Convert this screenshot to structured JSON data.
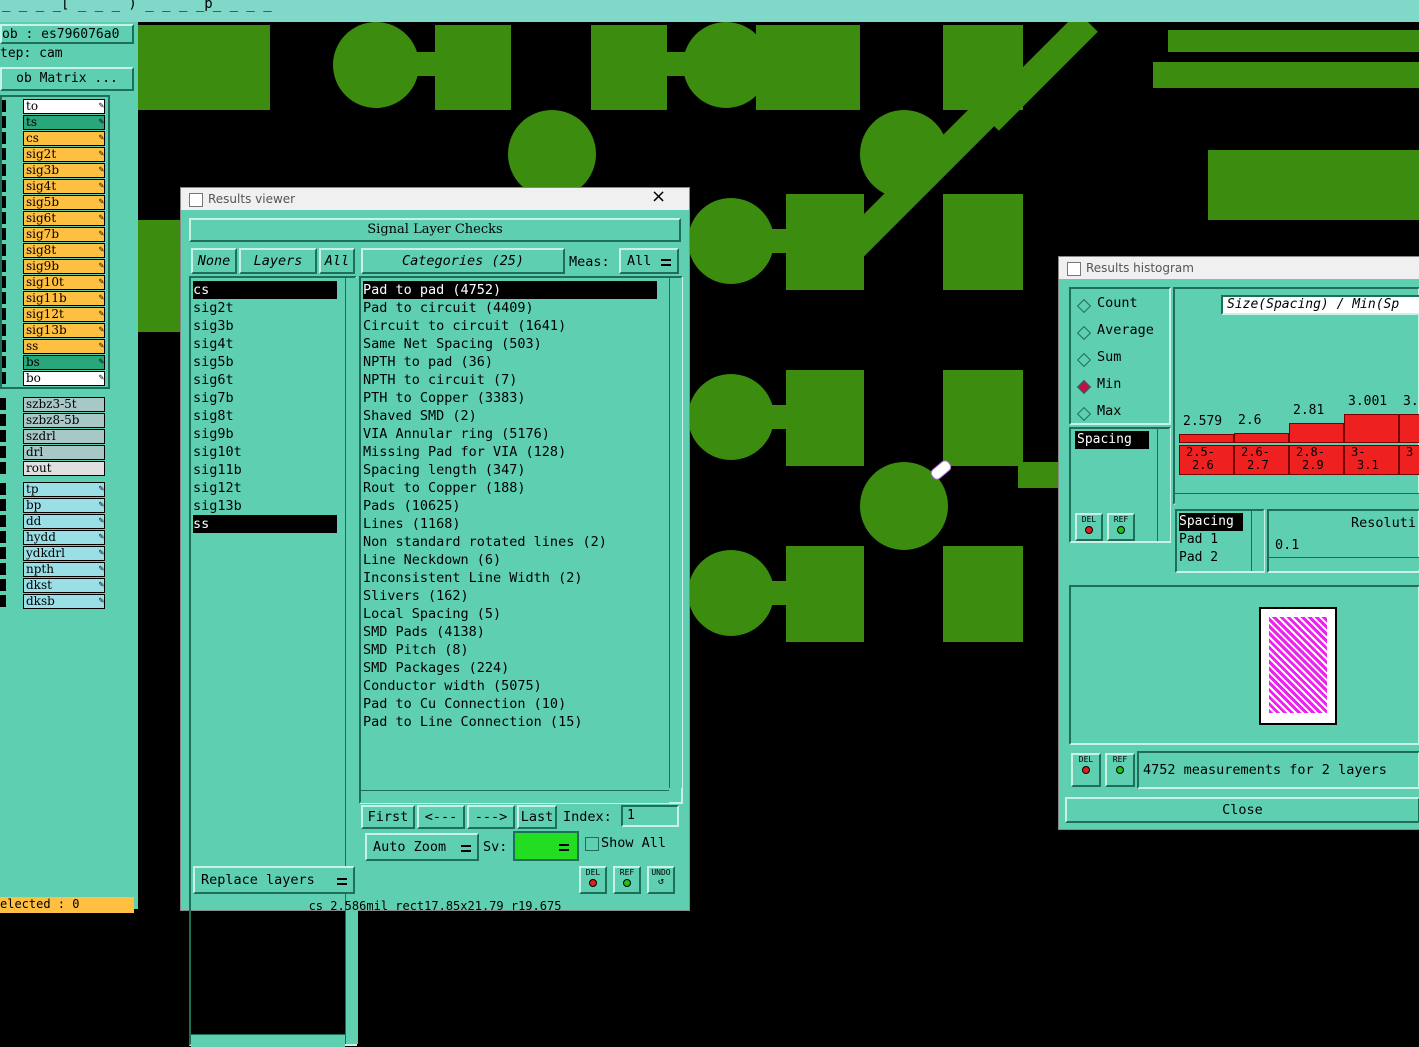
{
  "topbar": {
    "text": "_ _ _ _[ _ _ _ )  _ _ _ _p_ _ _  _"
  },
  "left_panel": {
    "job": "ob : es796076a0",
    "step": "tep: cam",
    "job_matrix": "ob Matrix ...",
    "layers_group1": [
      {
        "name": "to",
        "color": "#ffffff"
      },
      {
        "name": "ts",
        "color": "#2aa77a"
      },
      {
        "name": "cs",
        "color": "#ffbf40"
      },
      {
        "name": "sig2t",
        "color": "#ffbf40"
      },
      {
        "name": "sig3b",
        "color": "#ffbf40"
      },
      {
        "name": "sig4t",
        "color": "#ffbf40"
      },
      {
        "name": "sig5b",
        "color": "#ffbf40"
      },
      {
        "name": "sig6t",
        "color": "#ffbf40"
      },
      {
        "name": "sig7b",
        "color": "#ffbf40"
      },
      {
        "name": "sig8t",
        "color": "#ffbf40"
      },
      {
        "name": "sig9b",
        "color": "#ffbf40"
      },
      {
        "name": "sig10t",
        "color": "#ffbf40"
      },
      {
        "name": "sig11b",
        "color": "#ffbf40"
      },
      {
        "name": "sig12t",
        "color": "#ffbf40"
      },
      {
        "name": "sig13b",
        "color": "#ffbf40"
      },
      {
        "name": "ss",
        "color": "#ffbf40"
      },
      {
        "name": "bs",
        "color": "#2aa77a"
      },
      {
        "name": "bo",
        "color": "#ffffff"
      }
    ],
    "layers_group2": [
      {
        "name": "szbz3-5t",
        "color": "#a8c8c8"
      },
      {
        "name": "szbz8-5b",
        "color": "#a8c8c8"
      },
      {
        "name": "szdrl",
        "color": "#a8c8c8"
      },
      {
        "name": "drl",
        "color": "#a8c8c8"
      },
      {
        "name": "rout",
        "color": "#e0e0e0"
      }
    ],
    "layers_group3": [
      {
        "name": "tp",
        "color": "#9adfe6"
      },
      {
        "name": "bp",
        "color": "#9adfe6"
      },
      {
        "name": "dd",
        "color": "#9adfe6"
      },
      {
        "name": "hydd",
        "color": "#9adfe6"
      },
      {
        "name": "ydkdrl",
        "color": "#9adfe6"
      },
      {
        "name": "npth",
        "color": "#9adfe6"
      },
      {
        "name": "dkst",
        "color": "#9adfe6"
      },
      {
        "name": "dksb",
        "color": "#9adfe6"
      }
    ],
    "selected": "elected : 0"
  },
  "results_viewer": {
    "title": "Results viewer",
    "close": "×",
    "header": "Signal Layer Checks",
    "none_btn": "None",
    "layers_btn": "Layers",
    "all_btn": "All",
    "categories_btn": "Categories (25)",
    "meas_label": "Meas:",
    "meas_value": "All",
    "layers": [
      "cs",
      "sig2t",
      "sig3b",
      "sig4t",
      "sig5b",
      "sig6t",
      "sig7b",
      "sig8t",
      "sig9b",
      "sig10t",
      "sig11b",
      "sig12t",
      "sig13b",
      "ss"
    ],
    "categories": [
      "Pad to pad (4752)",
      "Pad to circuit (4409)",
      "Circuit to circuit (1641)",
      "Same Net Spacing (503)",
      "NPTH to pad (36)",
      "NPTH to circuit (7)",
      "PTH to Copper (3383)",
      "Shaved SMD (2)",
      "VIA Annular ring (5176)",
      "Missing Pad for VIA (128)",
      "Spacing length (347)",
      "Rout to Copper (188)",
      "Pads (10625)",
      "Lines (1168)",
      "Non standard rotated lines (2)",
      "Line Neckdown (6)",
      "Inconsistent Line Width (2)",
      "Slivers (162)",
      "Local Spacing (5)",
      "SMD Pads (4138)",
      "SMD Pitch (8)",
      "SMD Packages (224)",
      "Conductor width (5075)",
      "Pad to Cu Connection (10)",
      "Pad to Line Connection (15)"
    ],
    "first_btn": "First",
    "prev_btn": "<---",
    "next_btn": "--->",
    "last_btn": "Last",
    "index_label": "Index:",
    "index_value": "1",
    "auto_zoom_btn": "Auto Zoom",
    "sv_label": "Sv:",
    "show_all_label": "Show All",
    "replace_layers_btn": "Replace layers",
    "del_btn": "DEL",
    "ref_btn": "REF",
    "undo_btn": "UNDO",
    "status": "cs 2.586mil  rect17.85x21.79  r19.675"
  },
  "histogram": {
    "title": "Results histogram",
    "modes": [
      "Count",
      "Average",
      "Sum",
      "Min",
      "Max"
    ],
    "selected_mode": "Min",
    "chart_title": "Size(Spacing) / Min(Sp",
    "list1": [
      "Spacing"
    ],
    "del_btn": "DEL",
    "ref_btn": "REF",
    "list2": [
      "Spacing",
      "Pad 1",
      "Pad 2"
    ],
    "resolution_label": "Resoluti",
    "resolution_value": "0.1",
    "summary": "4752 measurements for 2 layers",
    "close_btn": "Close",
    "chart_data": {
      "type": "bar",
      "categories": [
        "2.5-\n2.6",
        "2.6-\n2.7",
        "2.8-\n2.9",
        "3-\n3.1",
        "3"
      ],
      "category_labels_top": [
        "2.5-",
        "2.6-",
        "2.8-",
        "3-",
        "3"
      ],
      "category_labels_bottom": [
        "2.6",
        "2.7",
        "2.9",
        "3.1",
        ""
      ],
      "values": [
        2.579,
        2.6,
        2.81,
        3.001,
        3
      ],
      "value_labels": [
        "2.579",
        "2.6",
        "2.81",
        "3.001",
        "3."
      ],
      "title": "Size(Spacing) / Min(Sp",
      "bar_color": "#ee2020"
    }
  }
}
